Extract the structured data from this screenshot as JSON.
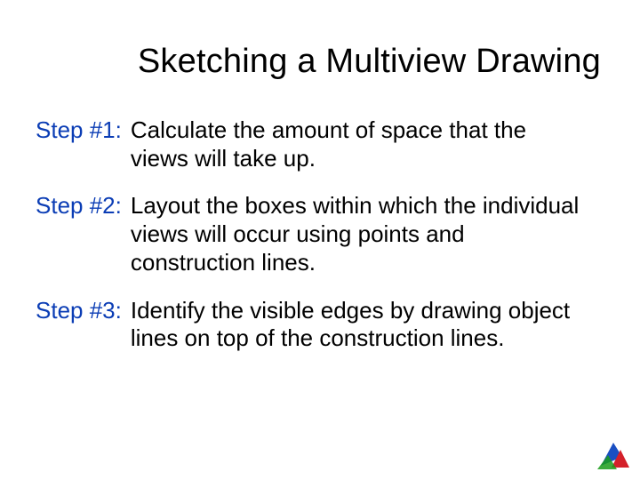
{
  "title": "Sketching a Multiview Drawing",
  "steps": [
    {
      "label": "Step #1:",
      "text": "Calculate the amount of space that the views will take up."
    },
    {
      "label": "Step #2:",
      "text": "Layout the boxes within which the individual views will occur using points and construction lines."
    },
    {
      "label": "Step #3:",
      "text": "Identify the visible edges by drawing object lines on top of the construction lines."
    }
  ]
}
